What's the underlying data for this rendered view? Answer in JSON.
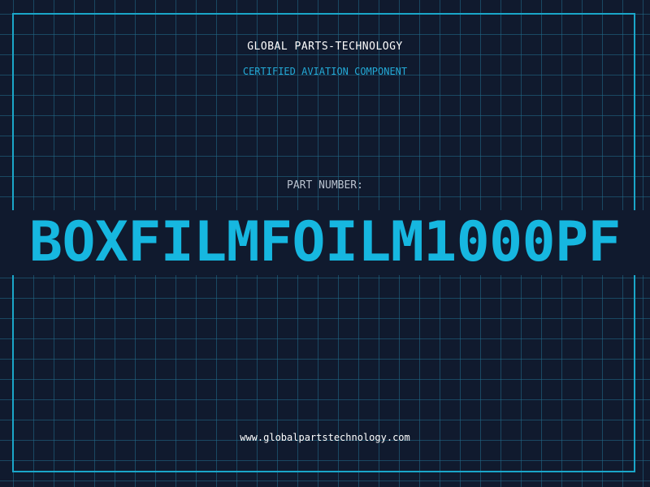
{
  "header": {
    "brand": "GLOBAL PARTS-TECHNOLOGY",
    "tagline": "CERTIFIED AVIATION COMPONENT"
  },
  "part": {
    "label": "PART NUMBER:",
    "number": "BOXFILMFOILM1000PF"
  },
  "footer": {
    "website": "www.globalpartstechnology.com"
  },
  "colors": {
    "background": "#101a2e",
    "grid": "#226e8c",
    "accent": "#16b7e0",
    "frame": "#1aa6c9",
    "text_primary": "#ffffff",
    "text_muted": "#b9c2cf"
  }
}
